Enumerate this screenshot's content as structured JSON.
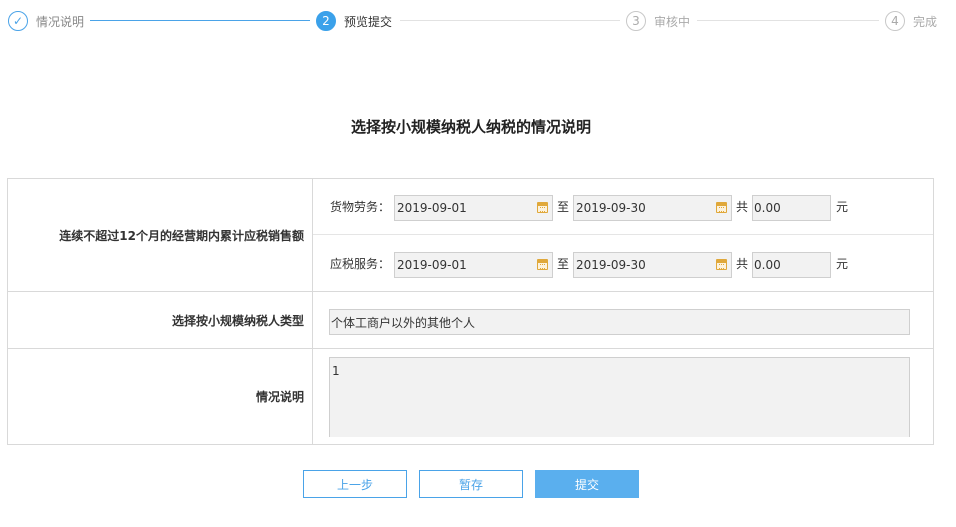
{
  "stepper": {
    "steps": [
      {
        "number": "✓",
        "label": "情况说明",
        "state": "done"
      },
      {
        "number": "2",
        "label": "预览提交",
        "state": "active"
      },
      {
        "number": "3",
        "label": "审核中",
        "state": "todo"
      },
      {
        "number": "4",
        "label": "完成",
        "state": "todo"
      }
    ]
  },
  "form": {
    "title": "选择按小规模纳税人纳税的情况说明",
    "sales": {
      "label": "连续不超过12个月的经营期内累计应税销售额",
      "goods": {
        "label": "货物劳务：",
        "start_date": "2019-09-01",
        "to_text": "至",
        "end_date": "2019-09-30",
        "total_text": "共",
        "amount": "0.00",
        "unit": "元"
      },
      "services": {
        "label": "应税服务：",
        "start_date": "2019-09-01",
        "to_text": "至",
        "end_date": "2019-09-30",
        "total_text": "共",
        "amount": "0.00",
        "unit": "元"
      }
    },
    "taxpayer_type": {
      "label": "选择按小规模纳税人类型",
      "value": "个体工商户以外的其他个人"
    },
    "description": {
      "label": "情况说明",
      "value": "1"
    }
  },
  "buttons": {
    "prev_label": "上一步",
    "save_label": "暂存",
    "submit_label": "提交"
  },
  "colors": {
    "accent": "#3ba1ea",
    "accent_light": "#5aafee",
    "step_todo": "#c8c8c8",
    "calendar_icon": "#e0a83a"
  }
}
